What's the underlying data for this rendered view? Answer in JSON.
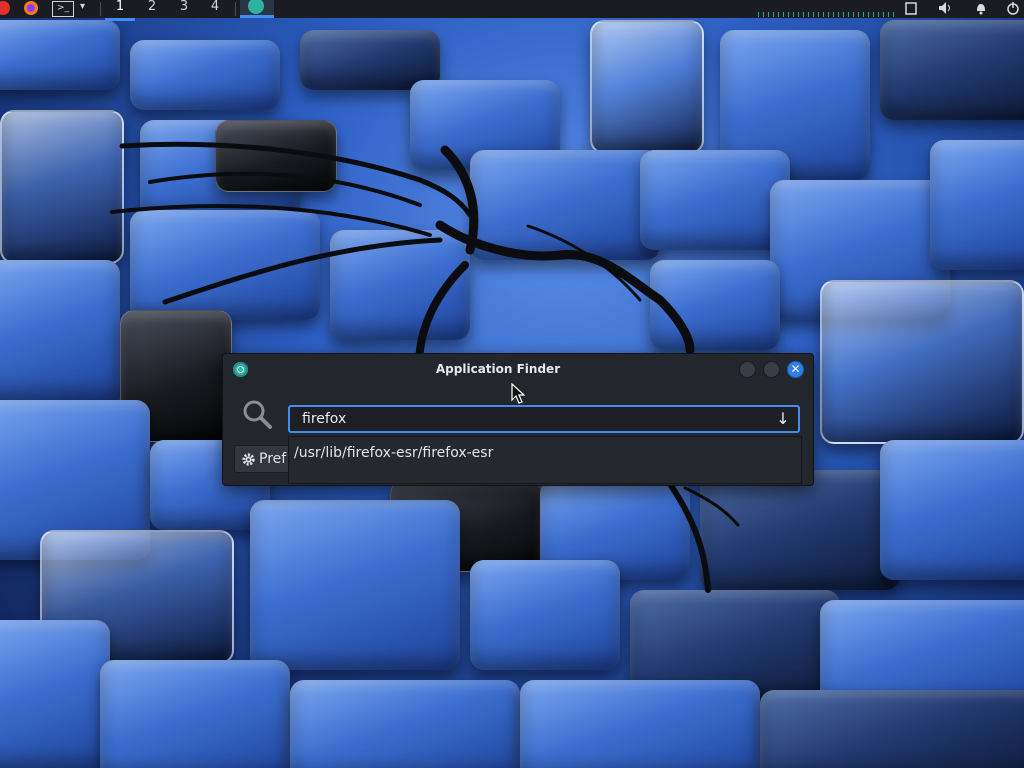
{
  "panel": {
    "workspaces": [
      "1",
      "2",
      "3",
      "4"
    ],
    "active_workspace": "1",
    "terminal_label": ">_"
  },
  "window": {
    "title": "Application Finder",
    "search_value": "firefox",
    "completion_entry": "/usr/lib/firefox-esr/firefox-esr",
    "prefs_label": "Pref",
    "close_glyph": "✕",
    "dropdown_glyph": "↓"
  },
  "colors": {
    "accent": "#3f8ff0",
    "app_icon": "#2fb3a0",
    "window_bg": "#24262d",
    "panel_bg": "#1a1c22"
  },
  "icons": {
    "app": "application-finder-icon",
    "search": "search-icon",
    "settings": "gear-icon",
    "close": "close-icon",
    "dropdown": "arrow-down-icon"
  }
}
